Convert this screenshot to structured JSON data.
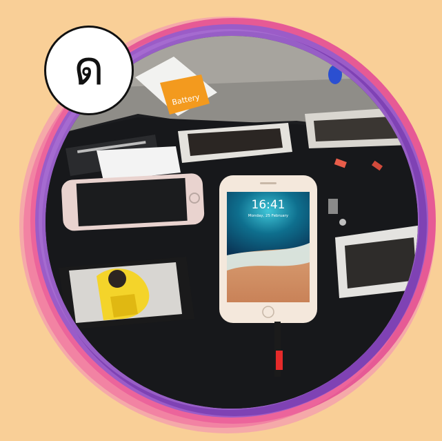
{
  "badge": {
    "letter": "ด"
  },
  "photo": {
    "subject": "phone-repair-workbench-photo",
    "phone_screen": {
      "time": "16:41",
      "date": "Monday, 25 February"
    },
    "battery_box_text": "Battery"
  },
  "colors": {
    "background": "#f9cf97",
    "ring_outer_pink": "#e65a95",
    "ring_inner_purple": "#8b4cb8",
    "badge_fill": "#ffffff",
    "badge_border": "#111111"
  }
}
